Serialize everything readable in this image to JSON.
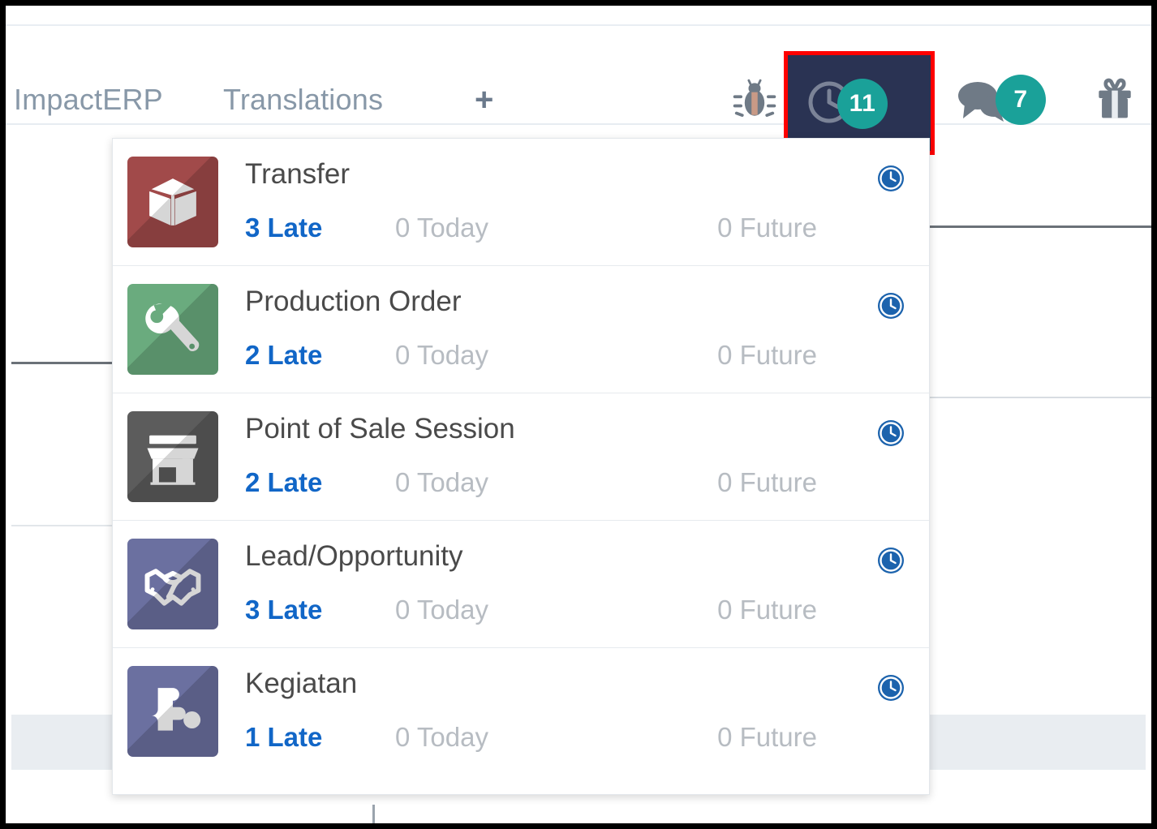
{
  "navbar": {
    "brand": "ImpactERP",
    "menu": "Translations",
    "add_label": "+",
    "bug_icon": "bug-icon",
    "gift_icon": "gift-icon",
    "activity_icon": "clock-icon",
    "activity_count": "11",
    "messages_icon": "chat-bubble-icon",
    "messages_count": "7"
  },
  "colors": {
    "badge": "#1aa199",
    "activity_button_bg": "#2a3353",
    "highlight_border": "#ff0000",
    "late_text": "#1166c7",
    "muted_text": "#b7bcc2",
    "title_text": "#4a4a4a",
    "clock_blue": "#1c63ad"
  },
  "dropdown": {
    "items": [
      {
        "title": "Transfer",
        "icon": "box-open-icon",
        "tile_color": "#a14a4a",
        "late": "3 Late",
        "today": "0 Today",
        "future": "0 Future",
        "row_icon": "clock-icon"
      },
      {
        "title": "Production Order",
        "icon": "wrench-icon",
        "tile_color": "#6aab7e",
        "late": "2 Late",
        "today": "0 Today",
        "future": "0 Future",
        "row_icon": "clock-icon"
      },
      {
        "title": "Point of Sale Session",
        "icon": "shop-icon",
        "tile_color": "#5c5c5c",
        "late": "2 Late",
        "today": "0 Today",
        "future": "0 Future",
        "row_icon": "clock-icon"
      },
      {
        "title": "Lead/Opportunity",
        "icon": "handshake-icon",
        "tile_color": "#6b70a0",
        "late": "3 Late",
        "today": "0 Today",
        "future": "0 Future",
        "row_icon": "clock-icon"
      },
      {
        "title": "Kegiatan",
        "icon": "puzzle-piece-icon",
        "tile_color": "#6b70a0",
        "late": "1 Late",
        "today": "0 Today",
        "future": "0 Future",
        "row_icon": "clock-icon"
      }
    ]
  }
}
